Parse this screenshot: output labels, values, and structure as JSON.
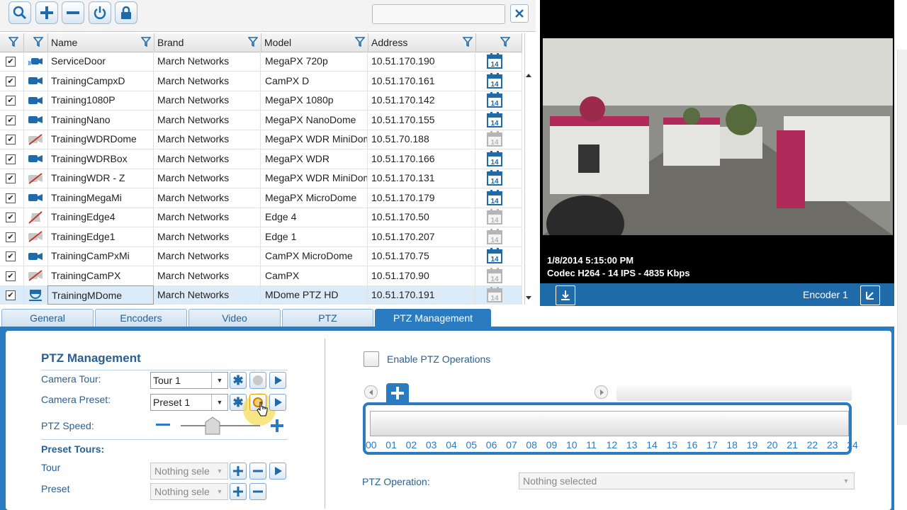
{
  "toolbar": {
    "buttons": [
      {
        "name": "search-button",
        "icon": "search-icon"
      },
      {
        "name": "add-button",
        "icon": "plus-icon"
      },
      {
        "name": "remove-button",
        "icon": "minus-icon"
      },
      {
        "name": "power-button",
        "icon": "power-icon"
      },
      {
        "name": "lock-button",
        "icon": "lock-icon"
      }
    ],
    "search_value": "",
    "close_icon": "close-icon"
  },
  "grid": {
    "headers": {
      "name": "Name",
      "brand": "Brand",
      "model": "Model",
      "address": "Address"
    },
    "rows": [
      {
        "name": "ServiceDoor",
        "brand": "March Networks",
        "model": "MegaPX 720p",
        "address": "10.51.170.190",
        "icon": "camera-wireless-icon",
        "cal": "active",
        "checked": true
      },
      {
        "name": "TrainingCampxD",
        "brand": "March Networks",
        "model": "CamPX D",
        "address": "10.51.170.161",
        "icon": "camera-icon",
        "cal": "active",
        "checked": true
      },
      {
        "name": "Training1080P",
        "brand": "March Networks",
        "model": "MegaPX 1080p",
        "address": "10.51.170.142",
        "icon": "camera-icon",
        "cal": "active",
        "checked": true
      },
      {
        "name": "TrainingNano",
        "brand": "March Networks",
        "model": "MegaPX NanoDome",
        "address": "10.51.170.155",
        "icon": "camera-icon",
        "cal": "active",
        "checked": true
      },
      {
        "name": "TrainingWDRDome",
        "brand": "March Networks",
        "model": "MegaPX WDR MiniDom",
        "address": "10.51.70.188",
        "icon": "camera-offline-icon",
        "cal": "inactive",
        "checked": true
      },
      {
        "name": "TrainingWDRBox",
        "brand": "March Networks",
        "model": "MegaPX WDR",
        "address": "10.51.170.166",
        "icon": "camera-icon",
        "cal": "active",
        "checked": true
      },
      {
        "name": "TrainingWDR - Z",
        "brand": "March Networks",
        "model": "MegaPX WDR MiniDom",
        "address": "10.51.170.131",
        "icon": "camera-offline-icon",
        "cal": "active",
        "checked": true
      },
      {
        "name": "TrainingMegaMi",
        "brand": "March Networks",
        "model": "MegaPX MicroDome",
        "address": "10.51.170.179",
        "icon": "camera-icon",
        "cal": "active",
        "checked": true
      },
      {
        "name": "TrainingEdge4",
        "brand": "March Networks",
        "model": "Edge 4",
        "address": "10.51.170.50",
        "icon": "encoder-offline-icon",
        "cal": "inactive",
        "checked": true
      },
      {
        "name": "TrainingEdge1",
        "brand": "March Networks",
        "model": "Edge 1",
        "address": "10.51.170.207",
        "icon": "camera-offline-icon",
        "cal": "inactive",
        "checked": true
      },
      {
        "name": "TrainingCamPxMi",
        "brand": "March Networks",
        "model": "CamPX MicroDome",
        "address": "10.51.170.75",
        "icon": "camera-icon",
        "cal": "active",
        "checked": true
      },
      {
        "name": "TrainingCamPX",
        "brand": "March Networks",
        "model": "CamPX",
        "address": "10.51.170.90",
        "icon": "camera-offline-icon",
        "cal": "inactive",
        "checked": true
      },
      {
        "name": "TrainingMDome",
        "brand": "March Networks",
        "model": "MDome PTZ HD",
        "address": "10.51.170.191",
        "icon": "dome-camera-icon",
        "cal": "inactive",
        "checked": true,
        "selected": true
      }
    ],
    "calendar_day": "14"
  },
  "video": {
    "timestamp": "1/8/2014 5:15:00 PM",
    "codec": "Codec H264 - 14 IPS - 4835 Kbps",
    "encoder_label": "Encoder 1"
  },
  "tabs": [
    {
      "label": "General"
    },
    {
      "label": "Encoders"
    },
    {
      "label": "Video"
    },
    {
      "label": "PTZ"
    },
    {
      "label": "PTZ Management",
      "active": true
    }
  ],
  "ptz": {
    "title": "PTZ Management",
    "camera_tour_label": "Camera Tour:",
    "camera_tour_value": "Tour 1",
    "camera_preset_label": "Camera Preset:",
    "camera_preset_value": "Preset 1",
    "speed_label": "PTZ Speed:",
    "speed_level": 0.4,
    "preset_tours_title": "Preset Tours:",
    "tour_label": "Tour",
    "tour_value": "Nothing sele",
    "preset_label": "Preset",
    "preset_value": "Nothing sele",
    "enable_label": "Enable PTZ Operations",
    "enable_checked": false,
    "hours": [
      "00",
      "01",
      "02",
      "03",
      "04",
      "05",
      "06",
      "07",
      "08",
      "09",
      "10",
      "11",
      "12",
      "13",
      "14",
      "15",
      "16",
      "17",
      "18",
      "19",
      "20",
      "21",
      "22",
      "23",
      "24"
    ],
    "operation_label": "PTZ Operation:",
    "operation_value": "Nothing selected"
  },
  "colors": {
    "accent": "#2a7bbf",
    "link_text": "#2a5f91",
    "header_bg": "#e4e4e4"
  }
}
